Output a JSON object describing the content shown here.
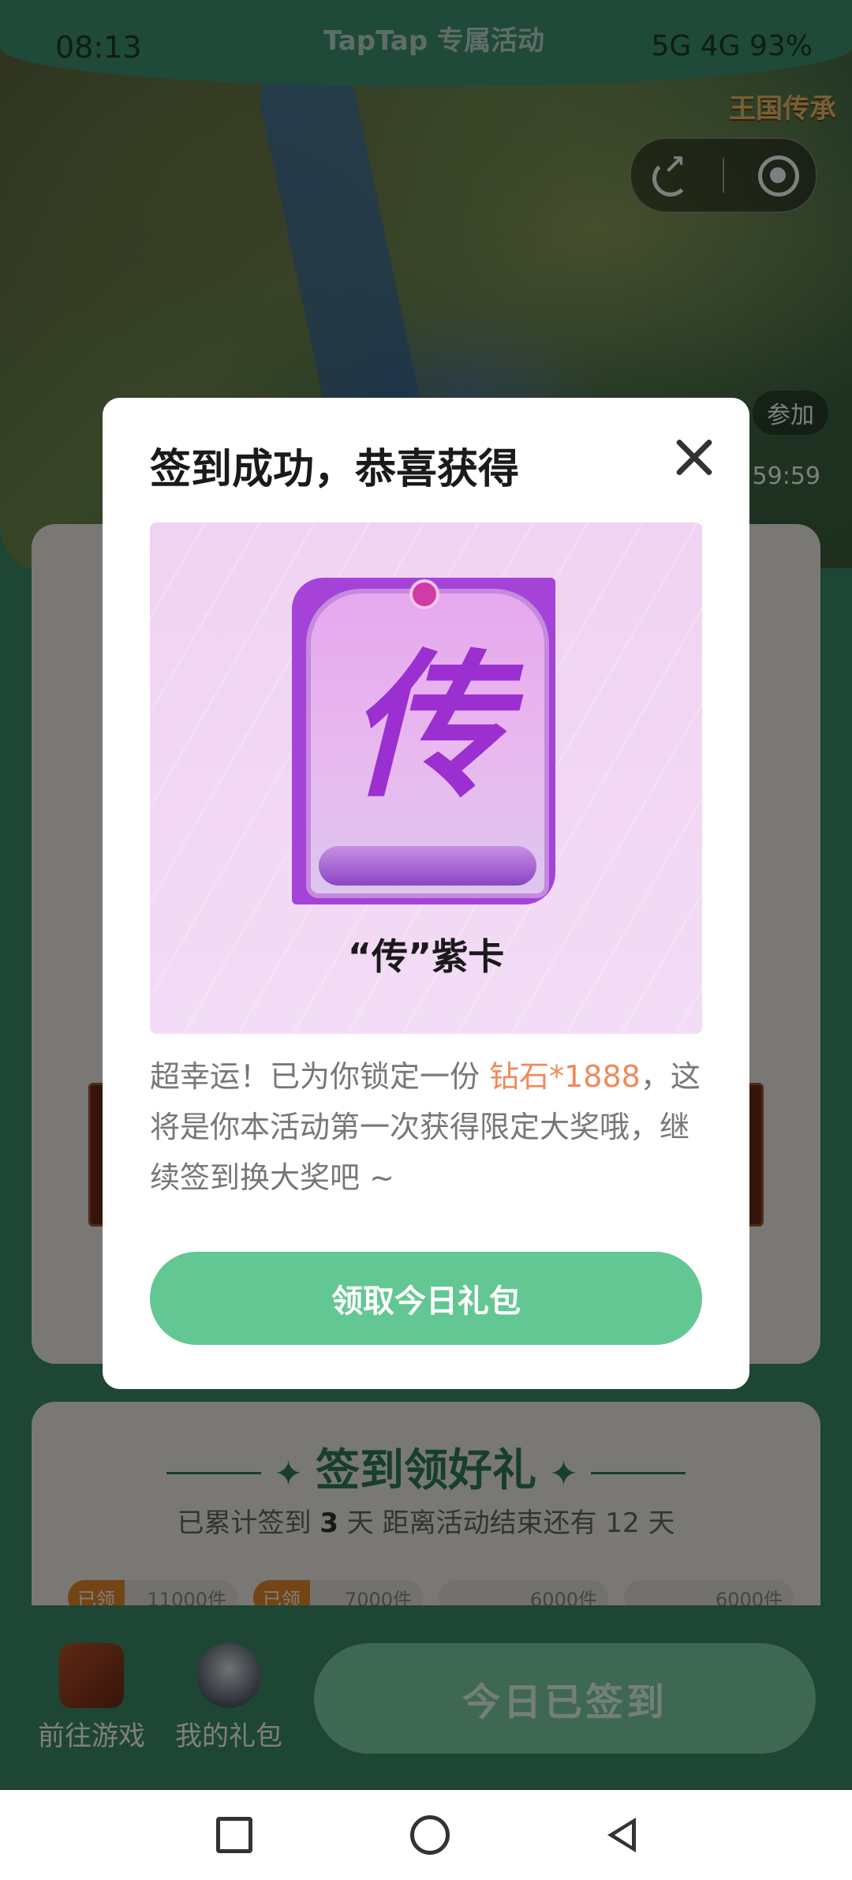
{
  "status_bar": {
    "time": "08:13",
    "center_text": "TapTap 专属活动",
    "right_text": "5G 4G 93%"
  },
  "header": {
    "game_logo": "王国传承",
    "join_chip": "参加",
    "timer": "59:59"
  },
  "modal": {
    "title": "签到成功，恭喜获得",
    "reward_glyph": "传",
    "reward_name": "“传”紫卡",
    "desc_before": "超幸运！已为你锁定一份 ",
    "desc_highlight": "钻石*1888",
    "desc_after": "，这将是你本活动第一次获得限定大奖哦，继续签到换大奖吧 ~",
    "claim_label": "领取今日礼包"
  },
  "checkin_section": {
    "title": "签到领好礼",
    "sub_prefix": "已累计签到 ",
    "days_signed": "3",
    "sub_middle": " 天  距离活动结束还有 12 天",
    "rewards": [
      {
        "tag": "已领",
        "amount": "11000件"
      },
      {
        "tag": "已领",
        "amount": "7000件"
      },
      {
        "tag": "",
        "amount": "6000件"
      },
      {
        "tag": "",
        "amount": "6000件"
      }
    ]
  },
  "bottom_bar": {
    "goto_game": "前往游戏",
    "my_gifts": "我的礼包",
    "checked_in": "今日已签到"
  },
  "colors": {
    "accent_green": "#63c794",
    "highlight_orange": "#ef8a5a",
    "card_purple": "#a543d8"
  }
}
